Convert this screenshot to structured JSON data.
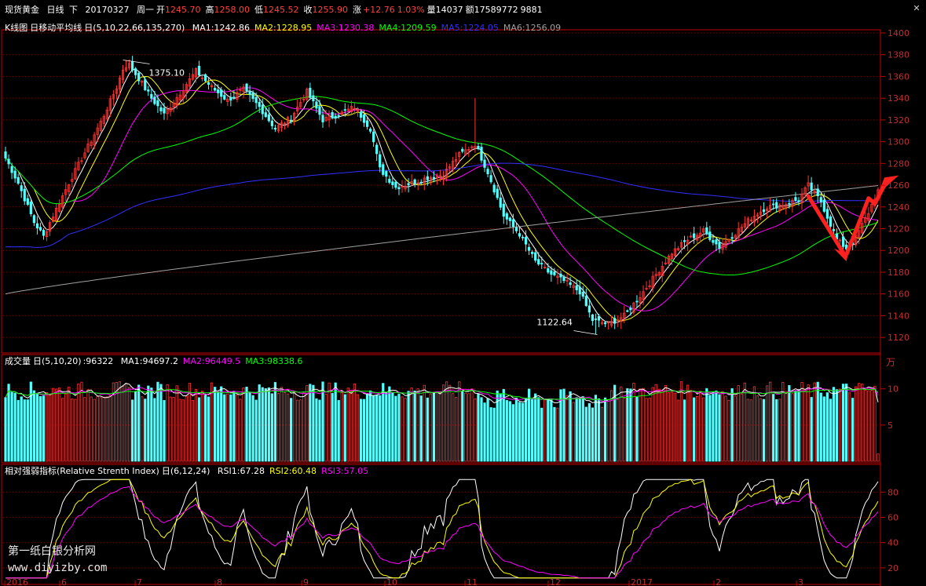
{
  "header": {
    "symbol": "现货黄金",
    "period": "日线",
    "direction": "下",
    "date": "20170327",
    "weekday": "周一",
    "open_label": "开",
    "open": "1245.70",
    "high_label": "高",
    "high": "1258.00",
    "low_label": "低",
    "low": "1245.52",
    "close_label": "收",
    "close": "1255.90",
    "change_label": "涨",
    "change": "+12.76",
    "change_pct": "1.03%",
    "volume_label": "量",
    "volume": "14037",
    "amount_label": "额",
    "amount": "17589772",
    "extra": "9881",
    "close_icon": "close-x-icon"
  },
  "panels": {
    "price": {
      "title": "K线图",
      "indicator": "日移动平均线",
      "params": "日(5,10,22,66,135,270)",
      "ma_labels": [
        {
          "text": "MA1:1242.86",
          "color": "#ffffff"
        },
        {
          "text": "MA2:1228.95",
          "color": "#ffff00"
        },
        {
          "text": "MA3:1230.38",
          "color": "#ff00ff"
        },
        {
          "text": "MA4:1209.59",
          "color": "#00ff00"
        },
        {
          "text": "MA5:1224.05",
          "color": "#3030ff"
        },
        {
          "text": "MA6:1256.09",
          "color": "#a0a0a0"
        }
      ],
      "yticks": [
        "1400",
        "1380",
        "1360",
        "1340",
        "1320",
        "1300",
        "1280",
        "1260",
        "1240",
        "1220",
        "1200",
        "1180",
        "1160",
        "1140",
        "1120"
      ]
    },
    "volume": {
      "title": "成交量",
      "params": "日(5,10,20)",
      "value": ":96322",
      "ma_labels": [
        {
          "text": "MA1:94697.2",
          "color": "#ffffff"
        },
        {
          "text": "MA2:96449.5",
          "color": "#ff00ff"
        },
        {
          "text": "MA3:98338.6",
          "color": "#00ff00"
        }
      ],
      "unit": "万",
      "yticks": [
        "10",
        "5"
      ]
    },
    "rsi": {
      "title": "相对强弱指标(Relative Strenth Index)",
      "params": "日(6,12,24)",
      "labels": [
        {
          "text": "RSI1:67.28",
          "color": "#ffffff"
        },
        {
          "text": "RSI2:60.48",
          "color": "#ffff00"
        },
        {
          "text": "RSI3:57.05",
          "color": "#ff00ff"
        }
      ],
      "yticks": [
        "80",
        "60",
        "40",
        "20"
      ]
    }
  },
  "colors": {
    "up": "#ff3232",
    "down": "#54ffff",
    "grid": "#7a0000",
    "axis": "#c00000",
    "arrow": "#ff2020"
  },
  "watermark": {
    "line1": "第一纸白银分析网",
    "line2": "www.diyizby.com"
  },
  "chart_data": [
    {
      "type": "candlestick",
      "title": "",
      "ylim": [
        1110,
        1400
      ],
      "x_tick_labels": [
        "2016",
        "6",
        "7",
        "8",
        "9",
        "10",
        "11",
        "12",
        "2017",
        "2",
        "3"
      ],
      "annotations": [
        {
          "text": "1375.10",
          "value": 1375.1
        },
        {
          "text": "1122.64",
          "value": 1122.64
        }
      ],
      "keypoints": [
        [
          0,
          1285
        ],
        [
          4,
          1262
        ],
        [
          9,
          1226
        ],
        [
          12,
          1213
        ],
        [
          15,
          1232
        ],
        [
          20,
          1262
        ],
        [
          25,
          1290
        ],
        [
          30,
          1318
        ],
        [
          35,
          1350
        ],
        [
          38,
          1375
        ],
        [
          42,
          1358
        ],
        [
          46,
          1340
        ],
        [
          50,
          1325
        ],
        [
          55,
          1345
        ],
        [
          60,
          1365
        ],
        [
          65,
          1350
        ],
        [
          70,
          1338
        ],
        [
          75,
          1348
        ],
        [
          80,
          1332
        ],
        [
          85,
          1312
        ],
        [
          90,
          1322
        ],
        [
          95,
          1346
        ],
        [
          100,
          1320
        ],
        [
          105,
          1325
        ],
        [
          110,
          1332
        ],
        [
          115,
          1312
        ],
        [
          118,
          1275
        ],
        [
          123,
          1258
        ],
        [
          128,
          1262
        ],
        [
          133,
          1267
        ],
        [
          138,
          1270
        ],
        [
          143,
          1288
        ],
        [
          148,
          1298
        ],
        [
          152,
          1272
        ],
        [
          157,
          1232
        ],
        [
          162,
          1215
        ],
        [
          167,
          1190
        ],
        [
          172,
          1178
        ],
        [
          176,
          1172
        ],
        [
          181,
          1162
        ],
        [
          185,
          1136
        ],
        [
          190,
          1132
        ],
        [
          195,
          1140
        ],
        [
          200,
          1158
        ],
        [
          205,
          1178
        ],
        [
          210,
          1198
        ],
        [
          215,
          1210
        ],
        [
          220,
          1218
        ],
        [
          225,
          1203
        ],
        [
          230,
          1216
        ],
        [
          235,
          1230
        ],
        [
          240,
          1240
        ],
        [
          245,
          1242
        ],
        [
          250,
          1247
        ],
        [
          253,
          1260
        ],
        [
          257,
          1245
        ],
        [
          262,
          1210
        ],
        [
          265,
          1202
        ],
        [
          268,
          1212
        ],
        [
          272,
          1235
        ],
        [
          275,
          1256
        ]
      ],
      "series": [
        {
          "name": "MA1",
          "period": 5,
          "color": "#ffffff"
        },
        {
          "name": "MA2",
          "period": 10,
          "color": "#ffff00"
        },
        {
          "name": "MA3",
          "period": 22,
          "color": "#ff00ff"
        },
        {
          "name": "MA4",
          "period": 66,
          "color": "#00ff00"
        },
        {
          "name": "MA5",
          "period": 135,
          "color": "#3030ff"
        },
        {
          "name": "MA6",
          "period": 270,
          "color": "#a0a0a0"
        }
      ]
    },
    {
      "type": "bar",
      "title": "",
      "ylim": [
        0,
        13
      ],
      "unit": "万",
      "typical_value": 9.6,
      "series": [
        {
          "name": "MA1",
          "color": "#ffffff"
        },
        {
          "name": "MA2",
          "color": "#ff00ff"
        },
        {
          "name": "MA3",
          "color": "#00ff00"
        }
      ]
    },
    {
      "type": "line",
      "title": "",
      "ylim": [
        10,
        92
      ],
      "series": [
        {
          "name": "RSI1",
          "period": 6,
          "color": "#ffffff"
        },
        {
          "name": "RSI2",
          "period": 12,
          "color": "#ffff00"
        },
        {
          "name": "RSI3",
          "period": 24,
          "color": "#ff00ff"
        }
      ]
    }
  ]
}
